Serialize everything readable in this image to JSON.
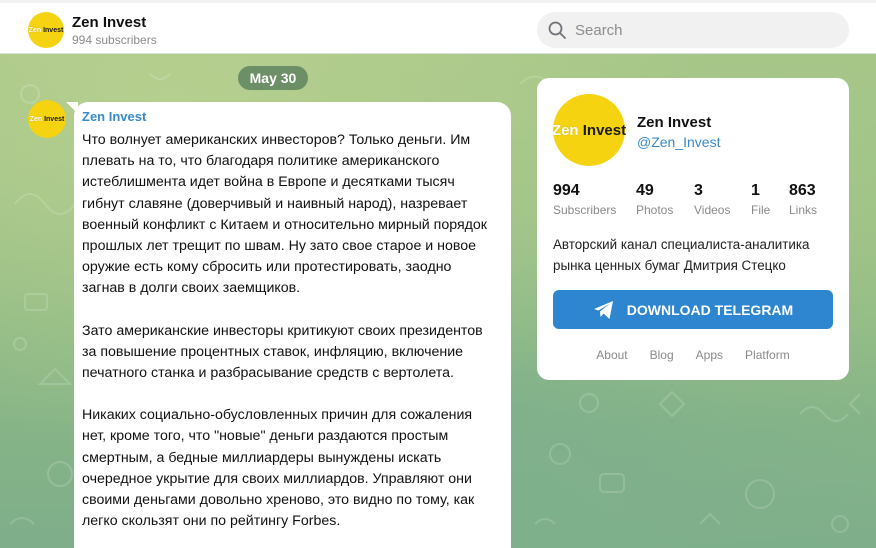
{
  "header": {
    "channel_name": "Zen Invest",
    "subscribers": "994 subscribers",
    "search_placeholder": "Search"
  },
  "avatar": {
    "word1": "Zen",
    "word2": "Invest",
    "color": "#f5d311"
  },
  "feed": {
    "date": "May 30",
    "message": {
      "author": "Zen Invest",
      "paragraphs": [
        "Что волнует американских инвесторов? Только деньги. Им плевать на то, что благодаря политике американского истеблишмента идет война в Европе и десятками тысяч гибнут славяне (доверчивый и наивный народ), назревает военный конфликт с Китаем и относительно мирный порядок прошлых лет трещит по швам. Ну зато свое старое и новое оружие есть кому сбросить или протестировать, заодно загнав в долги своих заемщиков.",
        "Зато американские инвесторы критикуют своих президентов за повышение процентных ставок, инфляцию, включение печатного станка и разбрасывание средств с вертолета.",
        "Никаких социально-обусловленных причин для сожаления нет, кроме того, что \"новые\" деньги раздаются простым смертным, а бедные миллиардеры вынуждены искать очередное укрытие для своих миллиардов. Управляют они своими деньгами довольно хреново, это видно по тому, как легко скользят они по рейтингу Forbes."
      ]
    }
  },
  "card": {
    "name": "Zen Invest",
    "handle": "@Zen_Invest",
    "stats": [
      {
        "value": "994",
        "label": "Subscribers"
      },
      {
        "value": "49",
        "label": "Photos"
      },
      {
        "value": "3",
        "label": "Videos"
      },
      {
        "value": "1",
        "label": "File"
      },
      {
        "value": "863",
        "label": "Links"
      }
    ],
    "description": "Авторский канал специалиста-аналитика рынка ценных бумаг Дмитрия Стецко",
    "download_label": "DOWNLOAD TELEGRAM",
    "links": [
      "About",
      "Blog",
      "Apps",
      "Platform"
    ]
  },
  "colors": {
    "accent": "#2e86d0",
    "link": "#3a8ac7",
    "background": "#8fb483"
  },
  "icons": [
    "search-icon",
    "telegram-plane-icon"
  ]
}
